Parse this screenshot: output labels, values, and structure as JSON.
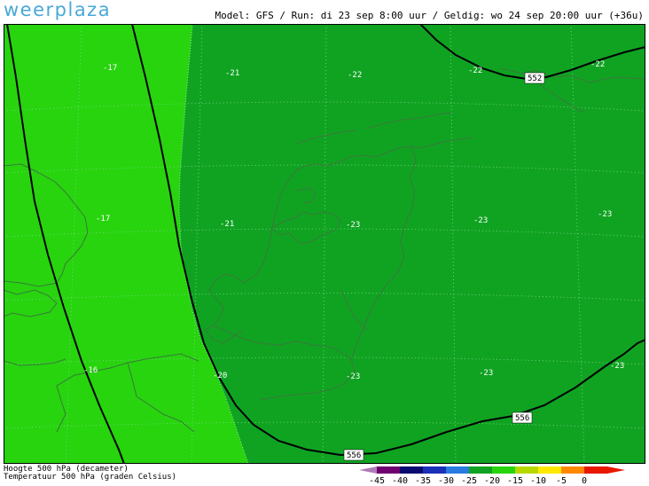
{
  "header": {
    "logo": "weerplaza",
    "model_info": "Model: GFS / Run: di 23 sep 8:00 uur / Geldig: wo 24 sep 20:00 uur (+36u)"
  },
  "map": {
    "colors": {
      "warm_zone": "#27d40e",
      "cold_zone": "#10a322",
      "contour": "#000000",
      "coastline": "#3a7a3a",
      "grid": "#7fd98a",
      "label": "#ffffff"
    },
    "temperature_labels": [
      "-17",
      "-21",
      "-22",
      "-22",
      "-22",
      "-17",
      "-21",
      "-23",
      "-23",
      "-23",
      "-16",
      "-20",
      "-23",
      "-23",
      "-23"
    ],
    "contour_labels": [
      "552",
      "556",
      "556"
    ]
  },
  "footer": {
    "line1": "Hoogte 500 hPa (decameter)",
    "line2": "Temperatuur 500 hPa (graden Celsius)"
  },
  "legend": {
    "ticks": [
      "-45",
      "-40",
      "-35",
      "-30",
      "-25",
      "-20",
      "-15",
      "-10",
      "-5",
      "0"
    ],
    "colors": [
      "#b07ab8",
      "#700070",
      "#0a0a70",
      "#1a30b8",
      "#2a7ae0",
      "#10a322",
      "#27d40e",
      "#b8d800",
      "#ffe800",
      "#ff8800",
      "#e81800"
    ]
  }
}
